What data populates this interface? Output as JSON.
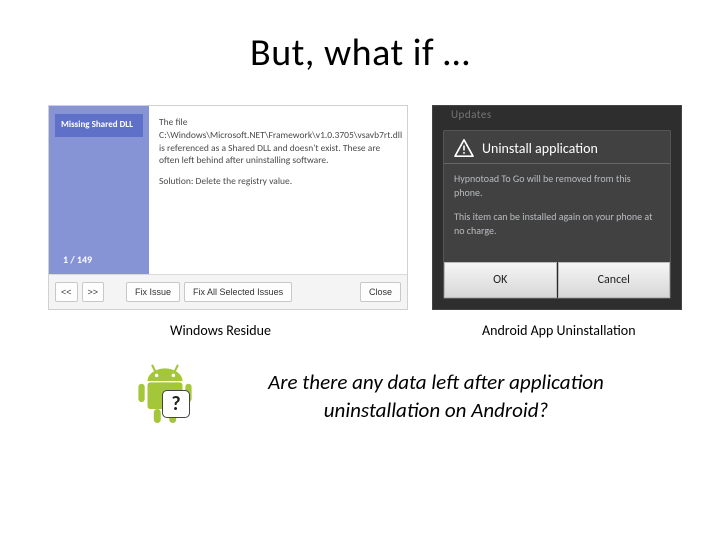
{
  "title": "But, what if …",
  "windows": {
    "sidebar_label": "Missing Shared DLL",
    "counter": "1 / 149",
    "body_line1": "The file C:\\Windows\\Microsoft.NET\\Framework\\v1.0.3705\\vsavb7rt.dll is referenced as a Shared DLL and doesn't exist. These are often left behind after uninstalling software.",
    "body_line2": "Solution: Delete the registry value.",
    "btn_prev": "<<",
    "btn_next": ">>",
    "btn_fix": "Fix Issue",
    "btn_fix_all": "Fix All Selected Issues",
    "btn_close": "Close"
  },
  "android": {
    "backdrop_label": "Updates",
    "dialog_title": "Uninstall application",
    "body_line1": "Hypnotoad To Go will be removed from this phone.",
    "body_line2": "This item can be installed again on your phone at no charge.",
    "btn_ok": "OK",
    "btn_cancel": "Cancel"
  },
  "caption_left": "Windows Residue",
  "caption_right": "Android App Uninstallation",
  "question": "Are there any data left after application uninstallation on Android?",
  "robot_q": "?"
}
